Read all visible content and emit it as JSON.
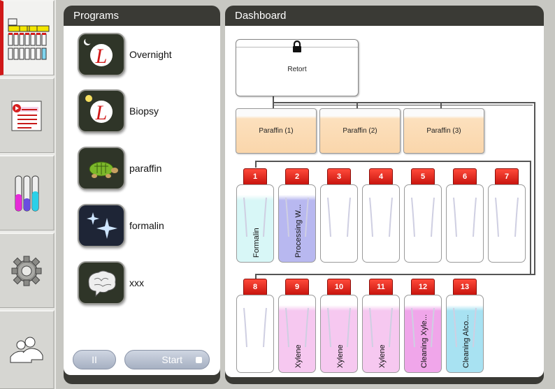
{
  "sidebar": {
    "items": [
      {
        "name": "dashboard-nav-icon",
        "active": true
      },
      {
        "name": "programs-list-nav-icon",
        "active": false
      },
      {
        "name": "reagents-nav-icon",
        "active": false
      },
      {
        "name": "settings-gear-nav-icon",
        "active": false
      },
      {
        "name": "users-nav-icon",
        "active": false
      }
    ]
  },
  "programs": {
    "title": "Programs",
    "items": [
      {
        "label": "Overnight",
        "icon": "moon-leica-logo-icon"
      },
      {
        "label": "Biopsy",
        "icon": "sun-leica-logo-icon"
      },
      {
        "label": "paraffin",
        "icon": "turtle-icon"
      },
      {
        "label": "formalin",
        "icon": "sparkle-stars-icon"
      },
      {
        "label": "xxx",
        "icon": "brain-icon"
      }
    ],
    "pause_label": "II",
    "start_label": "Start"
  },
  "dashboard": {
    "title": "Dashboard",
    "retort_label": "Retort",
    "paraffin_baths": [
      "Paraffin (1)",
      "Paraffin (2)",
      "Paraffin (3)"
    ],
    "bottles_row1": [
      {
        "number": "1",
        "label": "Formalin",
        "fill": "#d8f7f7"
      },
      {
        "number": "2",
        "label": "Processing W...",
        "fill": "#b8b8f0"
      },
      {
        "number": "3",
        "label": "",
        "fill": "#ffffff"
      },
      {
        "number": "4",
        "label": "",
        "fill": "#ffffff"
      },
      {
        "number": "5",
        "label": "",
        "fill": "#ffffff"
      },
      {
        "number": "6",
        "label": "",
        "fill": "#ffffff"
      },
      {
        "number": "7",
        "label": "",
        "fill": "#ffffff"
      }
    ],
    "bottles_row2": [
      {
        "number": "8",
        "label": "",
        "fill": "#ffffff"
      },
      {
        "number": "9",
        "label": "Xylene",
        "fill": "#f6c8f0"
      },
      {
        "number": "10",
        "label": "Xylene",
        "fill": "#f6c8f0"
      },
      {
        "number": "11",
        "label": "Xylene",
        "fill": "#f6c8f0"
      },
      {
        "number": "12",
        "label": "Cleaning Xyle...",
        "fill": "#f0a6ea"
      },
      {
        "number": "13",
        "label": "Cleaning Alco...",
        "fill": "#a8e2f2"
      }
    ]
  }
}
